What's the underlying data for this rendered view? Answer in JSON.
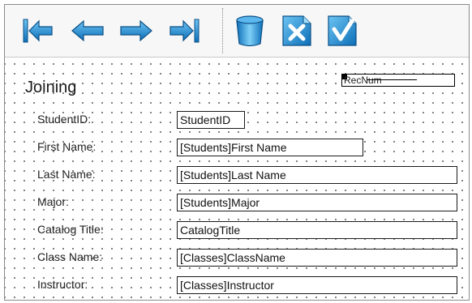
{
  "toolbar": {
    "buttons": [
      {
        "name": "first-record"
      },
      {
        "name": "previous-record"
      },
      {
        "name": "next-record"
      },
      {
        "name": "last-record"
      },
      {
        "name": "delete-record"
      },
      {
        "name": "cancel"
      },
      {
        "name": "accept"
      }
    ],
    "colors": {
      "arrow": "#1c8fd6",
      "arrow_dark": "#0b5f9e",
      "check": "#2a7fd0"
    }
  },
  "form": {
    "title": "Joining",
    "record_number": "RecNum",
    "fields": [
      {
        "label": "StudentID:",
        "value": "StudentID"
      },
      {
        "label": "First Name:",
        "value": "[Students]First Name"
      },
      {
        "label": "Last Name:",
        "value": "[Students]Last Name"
      },
      {
        "label": "Major:",
        "value": "[Students]Major"
      },
      {
        "label": "Catalog Title:",
        "value": "CatalogTitle"
      },
      {
        "label": "Class Name:",
        "value": "[Classes]ClassName"
      },
      {
        "label": "Instructor:",
        "value": "[Classes]Instructor"
      }
    ]
  }
}
